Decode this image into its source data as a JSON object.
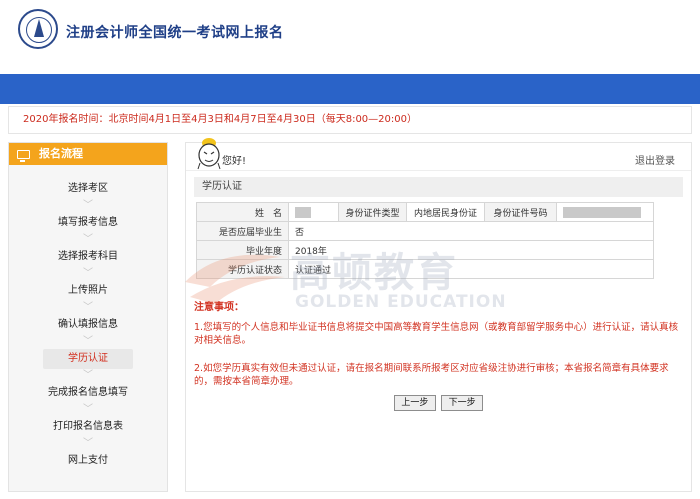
{
  "header": {
    "title": "注册会计师全国统一考试网上报名"
  },
  "notice": {
    "text": "2020年报名时间：北京时间4月1日至4月3日和4月7日至4月30日（每天8:00—20:00）"
  },
  "sidebar": {
    "title": "报名流程",
    "steps": [
      {
        "label": "选择考区"
      },
      {
        "label": "填写报考信息"
      },
      {
        "label": "选择报考科目"
      },
      {
        "label": "上传照片"
      },
      {
        "label": "确认填报信息"
      },
      {
        "label": "学历认证"
      },
      {
        "label": "完成报名信息填写"
      },
      {
        "label": "打印报名信息表"
      },
      {
        "label": "网上支付"
      }
    ],
    "active_step": "学历认证"
  },
  "panel": {
    "greeting": "您好!",
    "logout": "退出登录",
    "section_title": "学历认证",
    "table": {
      "name_label": "姓　名",
      "id_type_label": "身份证件类型",
      "id_type_value": "内地居民身份证",
      "id_no_label": "身份证件号码",
      "graduate_label": "是否应届毕业生",
      "graduate_value": "否",
      "year_label": "毕业年度",
      "year_value": "2018年",
      "status_label": "学历认证状态",
      "status_value": "认证通过"
    },
    "notes_title": "注意事项：",
    "note1": "1.您填写的个人信息和毕业证书信息将提交中国高等教育学生信息网（或教育部留学服务中心）进行认证，请认真核对相关信息。",
    "note2": "2.如您学历真实有效但未通过认证，请在报名期间联系所报考区对应省级注协进行审核；本省报名简章有具体要求的，需按本省简章办理。",
    "prev_button": "上一步",
    "next_button": "下一步"
  },
  "watermark": {
    "cn": "高顿教育",
    "en": "GOLDEN EDUCATION"
  },
  "colors": {
    "blue_bar": "#2a63c8",
    "accent_orange": "#f4a41c",
    "alert_red": "#d23322"
  }
}
